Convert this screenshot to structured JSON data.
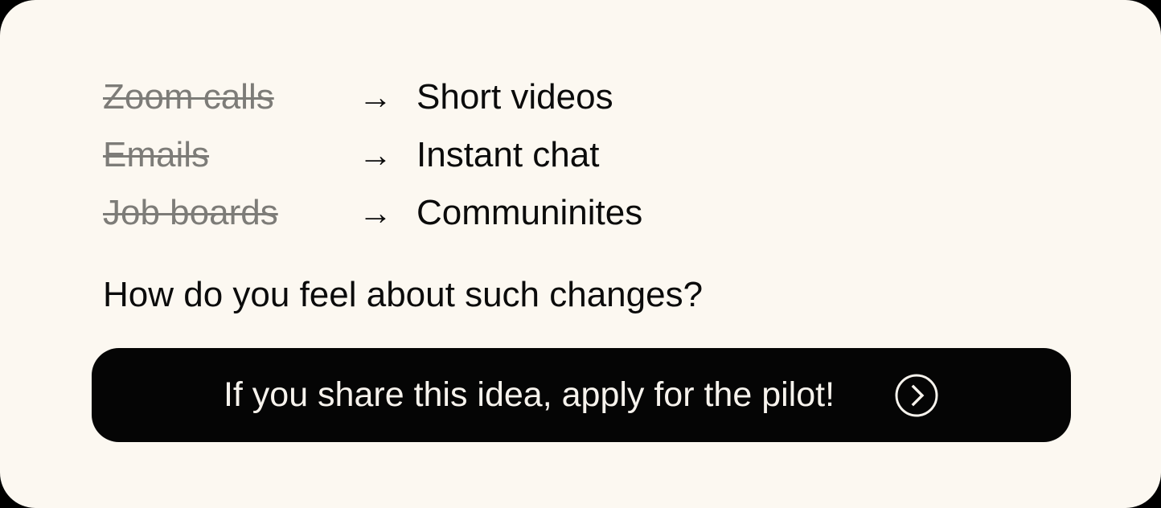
{
  "card": {
    "background_color": "#FCF8F1",
    "text_color": "#0B0B0B",
    "muted_color": "#7D7C78",
    "accent_color": "#050505"
  },
  "transitions": {
    "arrow_glyph": "→",
    "rows": [
      {
        "old": "Zoom calls",
        "arrow": "→",
        "new": "Short videos"
      },
      {
        "old": "Emails",
        "arrow": "→",
        "new": "Instant chat"
      },
      {
        "old": "Job boards",
        "arrow": "→",
        "new": "Communinites"
      }
    ]
  },
  "question": {
    "text": "How do you feel about such changes?"
  },
  "cta": {
    "label": "If you share this idea, apply for the pilot!",
    "icon": "chevron-right-circle-icon",
    "background_color": "#050505",
    "label_color": "#F7F3ED"
  }
}
